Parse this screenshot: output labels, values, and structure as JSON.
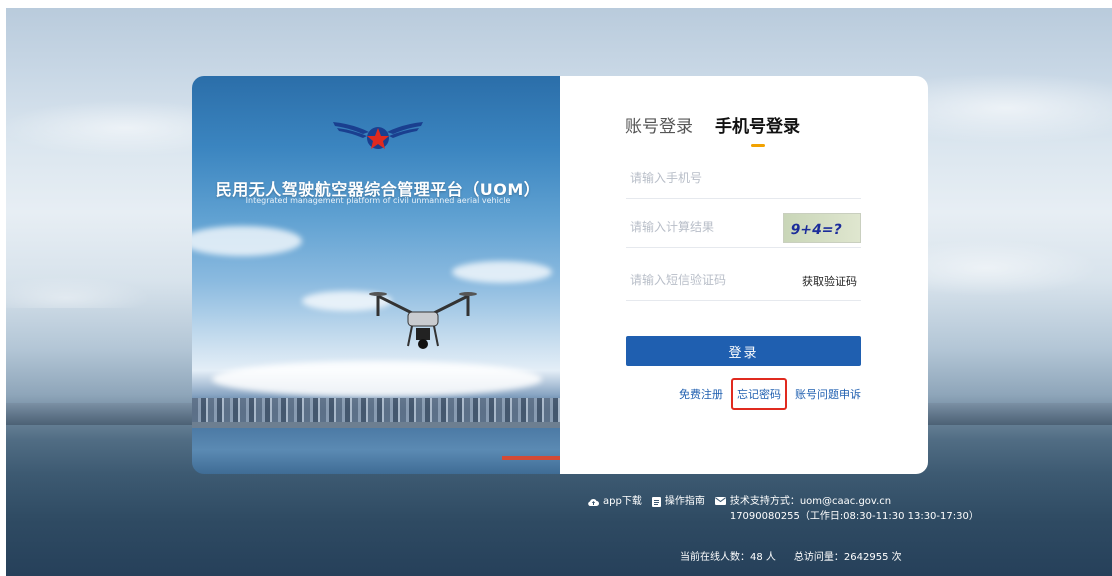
{
  "hero": {
    "title": "民用无人驾驶航空器综合管理平台（UOM）",
    "subtitle": "Integrated management platform of civil unmanned aerial vehicle"
  },
  "login": {
    "tabs": [
      {
        "label": "账号登录",
        "active": false
      },
      {
        "label": "手机号登录",
        "active": true
      }
    ],
    "phone_placeholder": "请输入手机号",
    "calc_placeholder": "请输入计算结果",
    "captcha_text": "9+4=?",
    "sms_placeholder": "请输入短信验证码",
    "get_code_label": "获取验证码",
    "submit_label": "登录",
    "links": {
      "register": "免费注册",
      "forgot": "忘记密码",
      "appeal": "账号问题申诉"
    }
  },
  "footer": {
    "app_download": "app下载",
    "guide": "操作指南",
    "support_line1": "技术支持方式：uom@caac.gov.cn",
    "support_line2": "17090080255（工作日:08:30-11:30 13:30-17:30）",
    "online_users": "当前在线人数：48 人",
    "total_visits": "总访问量：2642955 次"
  },
  "colors": {
    "primary": "#1f5fb0",
    "tab_indicator": "#f2a200",
    "highlight_box": "#e02a1f"
  },
  "icons": [
    "logo-wings-icon",
    "drone-illustration",
    "cloud-upload-icon",
    "document-icon",
    "mail-icon"
  ]
}
